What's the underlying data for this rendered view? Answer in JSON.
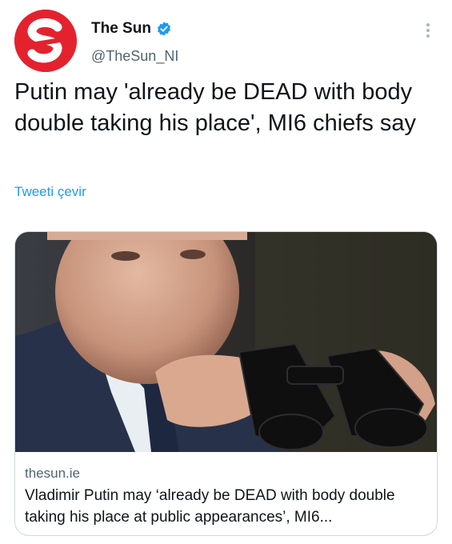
{
  "author": {
    "display_name": "The Sun",
    "handle": "@TheSun_NI",
    "avatar_letter": "S",
    "avatar_color": "#e4222e",
    "verified": true
  },
  "tweet": {
    "text": "Putin may 'already be DEAD with body double taking his place', MI6 chiefs say",
    "translate_label": "Tweeti çevir"
  },
  "card": {
    "domain": "thesun.ie",
    "title": "Vladimir Putin may ‘already be DEAD with body double taking his place at public appearances’, MI6..."
  },
  "colors": {
    "link": "#1d9bf0",
    "secondary_text": "#536471",
    "border": "#cfd9de"
  },
  "icons": {
    "verified": "verified-badge-icon",
    "more": "more-options-icon"
  }
}
